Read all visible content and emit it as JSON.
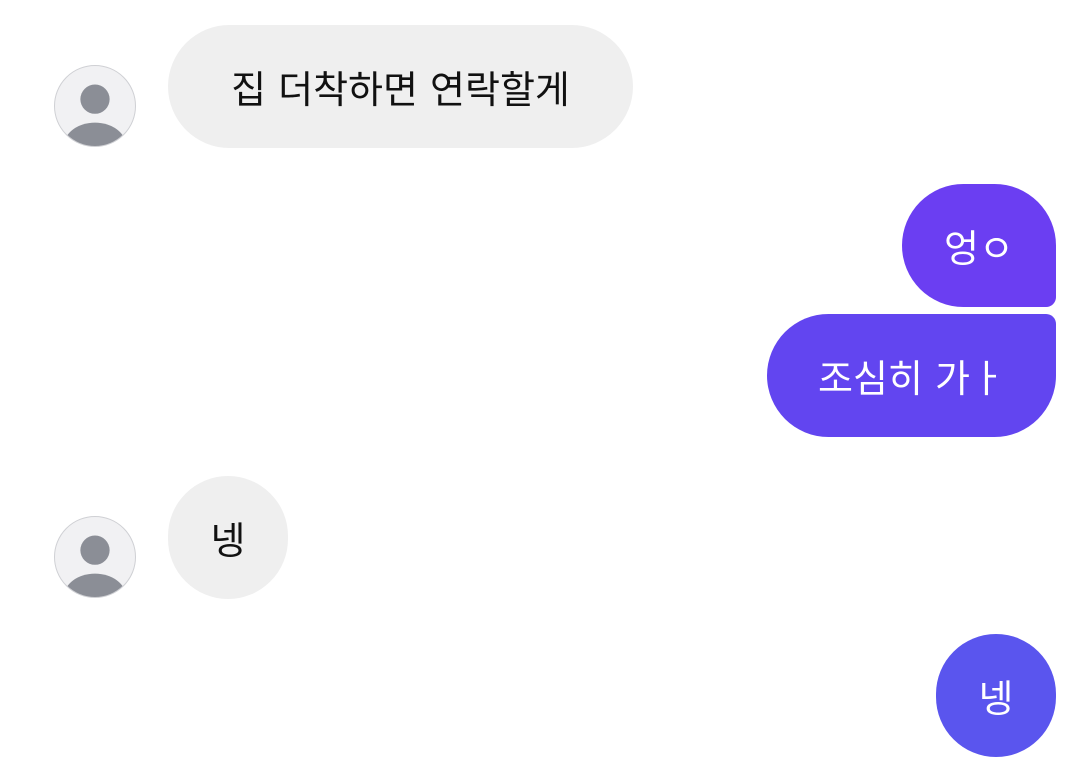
{
  "conversation": {
    "messages": [
      {
        "sender": "contact",
        "text": "집 더착하면 연락할게"
      },
      {
        "sender": "me",
        "text": "엉ㅇ"
      },
      {
        "sender": "me",
        "text": "조심히 가ㅏ"
      },
      {
        "sender": "contact",
        "text": "넹"
      },
      {
        "sender": "me",
        "text": "넹"
      }
    ]
  },
  "colors": {
    "incoming_bubble": "#efefef",
    "outgoing_bubble_top": "#6b3ef2",
    "outgoing_bubble_bottom": "#5a55ee",
    "avatar_placeholder": "#8b8e96"
  },
  "icons": {
    "avatar": "person-silhouette-icon"
  }
}
